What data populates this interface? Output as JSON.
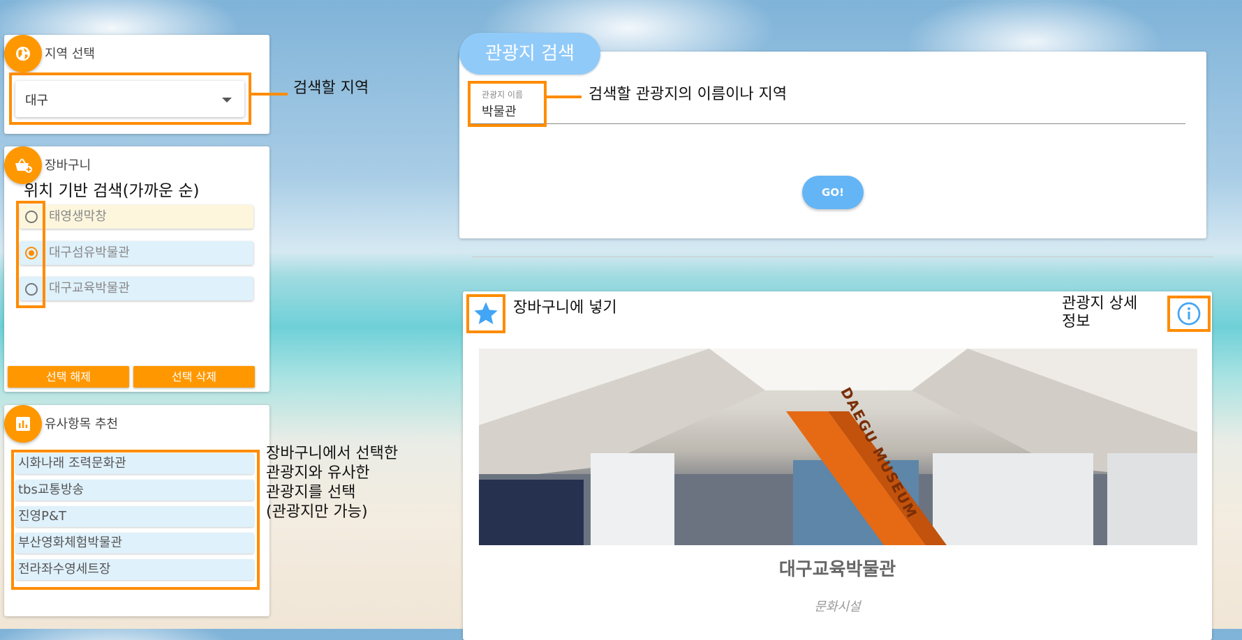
{
  "region": {
    "title": "지역 선택",
    "selected": "대구",
    "annotation": "검색할 지역",
    "icon": "globe-icon"
  },
  "cart": {
    "title": "장바구니",
    "subtitle": "위치 기반 검색(가까운 순)",
    "icon": "basket-add-icon",
    "items": [
      {
        "label": "태영생막창",
        "selected": false,
        "color": "#fdf6dd"
      },
      {
        "label": "대구섬유박물관",
        "selected": true,
        "color": "#dff1fb"
      },
      {
        "label": "대구교육박물관",
        "selected": false,
        "color": "#dff1fb"
      }
    ],
    "deselect_label": "선택 해제",
    "delete_label": "선택 삭제"
  },
  "similar": {
    "title": "유사항목 추천",
    "icon": "chart-icon",
    "items": [
      "시화나래 조력문화관",
      "tbs교통방송",
      "진영P&T",
      "부산영화체험박물관",
      "전라좌수영세트장"
    ],
    "annotation_lines": [
      "장바구니에서 선택한",
      "관광지와 유사한",
      "관광지를 선택",
      "(관광지만 가능)"
    ]
  },
  "search": {
    "tab_label": "관광지 검색",
    "field_label": "관광지 이름",
    "field_value": "박물관",
    "annotation": "검색할 관광지의 이름이나 지역",
    "go_label": "GO!"
  },
  "result": {
    "add_to_cart_annotation": "장바구니에 넣기",
    "detail_annotation_lines": [
      "관광지 상세",
      "정보"
    ],
    "image_sign_text": "DAEGU MUSEUM",
    "name": "대구교육박물관",
    "category": "문화시설",
    "icons": [
      "star-icon",
      "info-icon"
    ]
  },
  "colors": {
    "accent_orange": "#ff9800",
    "highlight_orange": "#ff8c00",
    "go_blue": "#64b5f6",
    "tab_blue": "#90caf9",
    "star_blue": "#42a5f5"
  }
}
